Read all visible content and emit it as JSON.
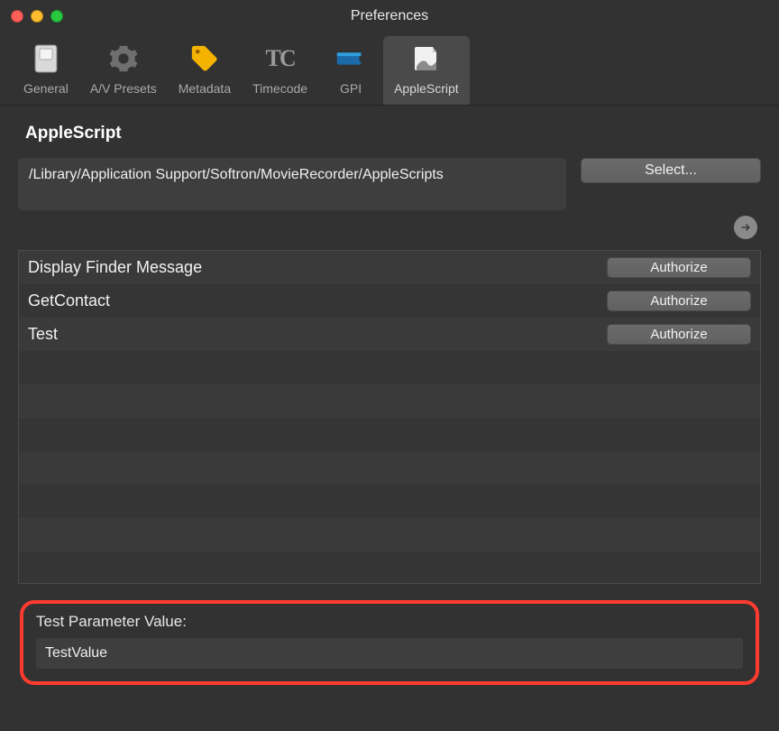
{
  "window": {
    "title": "Preferences"
  },
  "toolbar": {
    "items": [
      {
        "label": "General",
        "icon": "switch-icon",
        "selected": false
      },
      {
        "label": "A/V Presets",
        "icon": "gear-icon",
        "selected": false
      },
      {
        "label": "Metadata",
        "icon": "tag-icon",
        "selected": false
      },
      {
        "label": "Timecode",
        "icon": "tc-icon",
        "selected": false
      },
      {
        "label": "GPI",
        "icon": "gpi-icon",
        "selected": false
      },
      {
        "label": "AppleScript",
        "icon": "script-icon",
        "selected": true
      }
    ]
  },
  "section": {
    "title": "AppleScript"
  },
  "path": {
    "value": "/Library/Application Support/Softron/MovieRecorder/AppleScripts",
    "select_label": "Select..."
  },
  "scripts": [
    {
      "name": "Display Finder Message",
      "action": "Authorize"
    },
    {
      "name": "GetContact",
      "action": "Authorize"
    },
    {
      "name": "Test",
      "action": "Authorize"
    }
  ],
  "param": {
    "label": "Test Parameter Value:",
    "value": "TestValue"
  }
}
